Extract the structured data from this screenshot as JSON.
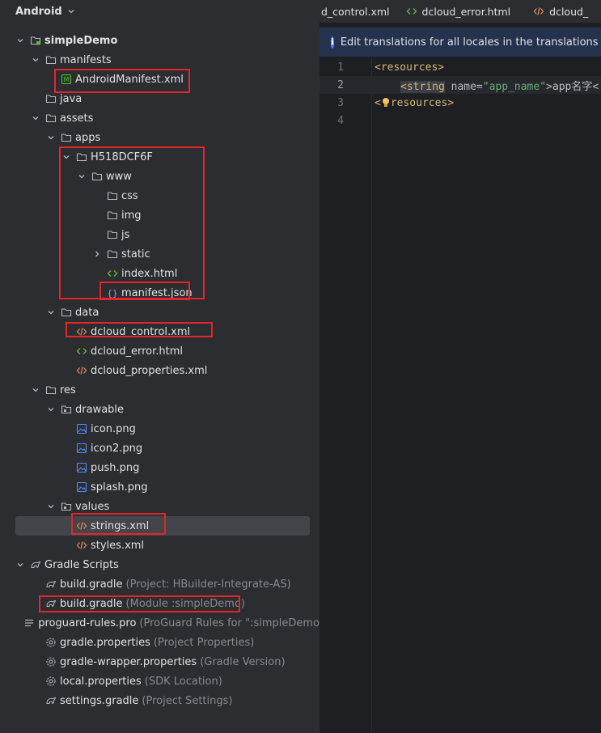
{
  "project_panel": {
    "title": "Android",
    "tree": [
      {
        "label": "simpleDemo",
        "hint": "",
        "icon": "module-folder-icon",
        "arrow": "expanded",
        "bold": true
      },
      {
        "label": "manifests",
        "hint": "",
        "icon": "folder-icon",
        "arrow": "expanded"
      },
      {
        "label": "AndroidManifest.xml",
        "hint": "",
        "icon": "manifest-file-icon",
        "arrow": "none"
      },
      {
        "label": "java",
        "hint": "",
        "icon": "folder-icon",
        "arrow": "none"
      },
      {
        "label": "assets",
        "hint": "",
        "icon": "folder-icon",
        "arrow": "expanded"
      },
      {
        "label": "apps",
        "hint": "",
        "icon": "folder-icon",
        "arrow": "expanded"
      },
      {
        "label": "H518DCF6F",
        "hint": "",
        "icon": "folder-icon",
        "arrow": "expanded"
      },
      {
        "label": "www",
        "hint": "",
        "icon": "folder-icon",
        "arrow": "expanded"
      },
      {
        "label": "css",
        "hint": "",
        "icon": "folder-icon",
        "arrow": "none"
      },
      {
        "label": "img",
        "hint": "",
        "icon": "folder-icon",
        "arrow": "none"
      },
      {
        "label": "js",
        "hint": "",
        "icon": "folder-icon",
        "arrow": "none"
      },
      {
        "label": "static",
        "hint": "",
        "icon": "folder-icon",
        "arrow": "collapsed"
      },
      {
        "label": "index.html",
        "hint": "",
        "icon": "html-file-icon",
        "arrow": "none"
      },
      {
        "label": "manifest.json",
        "hint": "",
        "icon": "json-file-icon",
        "arrow": "none"
      },
      {
        "label": "data",
        "hint": "",
        "icon": "folder-icon",
        "arrow": "expanded"
      },
      {
        "label": "dcloud_control.xml",
        "hint": "",
        "icon": "xml-file-icon",
        "arrow": "none"
      },
      {
        "label": "dcloud_error.html",
        "hint": "",
        "icon": "html-file-icon",
        "arrow": "none"
      },
      {
        "label": "dcloud_properties.xml",
        "hint": "",
        "icon": "xml-file-icon",
        "arrow": "none"
      },
      {
        "label": "res",
        "hint": "",
        "icon": "folder-icon",
        "arrow": "expanded"
      },
      {
        "label": "drawable",
        "hint": "",
        "icon": "res-folder-icon",
        "arrow": "expanded"
      },
      {
        "label": "icon.png",
        "hint": "",
        "icon": "image-file-icon",
        "arrow": "none"
      },
      {
        "label": "icon2.png",
        "hint": "",
        "icon": "image-file-icon",
        "arrow": "none"
      },
      {
        "label": "push.png",
        "hint": "",
        "icon": "image-file-icon",
        "arrow": "none"
      },
      {
        "label": "splash.png",
        "hint": "",
        "icon": "image-file-icon",
        "arrow": "none"
      },
      {
        "label": "values",
        "hint": "",
        "icon": "res-folder-icon",
        "arrow": "expanded"
      },
      {
        "label": "strings.xml",
        "hint": "",
        "icon": "xml-file-icon",
        "arrow": "none",
        "selected": true
      },
      {
        "label": "styles.xml",
        "hint": "",
        "icon": "xml-file-icon",
        "arrow": "none"
      },
      {
        "label": "Gradle Scripts",
        "hint": "",
        "icon": "gradle-icon",
        "arrow": "expanded"
      },
      {
        "label": "build.gradle",
        "hint": "(Project: HBuilder-Integrate-AS)",
        "icon": "gradle-icon",
        "arrow": "none"
      },
      {
        "label": "build.gradle",
        "hint": "(Module :simpleDemo)",
        "icon": "gradle-icon",
        "arrow": "none"
      },
      {
        "label": "proguard-rules.pro",
        "hint": "(ProGuard Rules for \":simpleDemo",
        "icon": "text-file-icon",
        "arrow": "none"
      },
      {
        "label": "gradle.properties",
        "hint": "(Project Properties)",
        "icon": "settings-icon",
        "arrow": "none"
      },
      {
        "label": "gradle-wrapper.properties",
        "hint": "(Gradle Version)",
        "icon": "settings-icon",
        "arrow": "none"
      },
      {
        "label": "local.properties",
        "hint": "(SDK Location)",
        "icon": "settings-icon",
        "arrow": "none"
      },
      {
        "label": "settings.gradle",
        "hint": "(Project Settings)",
        "icon": "gradle-icon",
        "arrow": "none"
      }
    ]
  },
  "editor": {
    "tabs": [
      {
        "label": "d_control.xml",
        "icon": "none"
      },
      {
        "label": "dcloud_error.html",
        "icon": "html-file-icon"
      },
      {
        "label": "dcloud_",
        "icon": "xml-file-icon"
      }
    ],
    "banner_text": "Edit translations for all locales in the translations editor",
    "line_numbers": [
      "1",
      "2",
      "3",
      "4"
    ],
    "code": {
      "l1_open": "<resources>",
      "l2_tag_open": "<string",
      "l2_attr": " name=",
      "l2_value": "\"app_name\"",
      "l2_text": ">app名字<",
      "l3_start": "<",
      "l3_end": "resources>"
    }
  },
  "colors": {
    "panel_bg": "#2b2d30",
    "editor_bg": "#1e1f22",
    "highlight_box": "#e5252a",
    "selection": "#43454a",
    "banner_bg": "#25324d"
  }
}
